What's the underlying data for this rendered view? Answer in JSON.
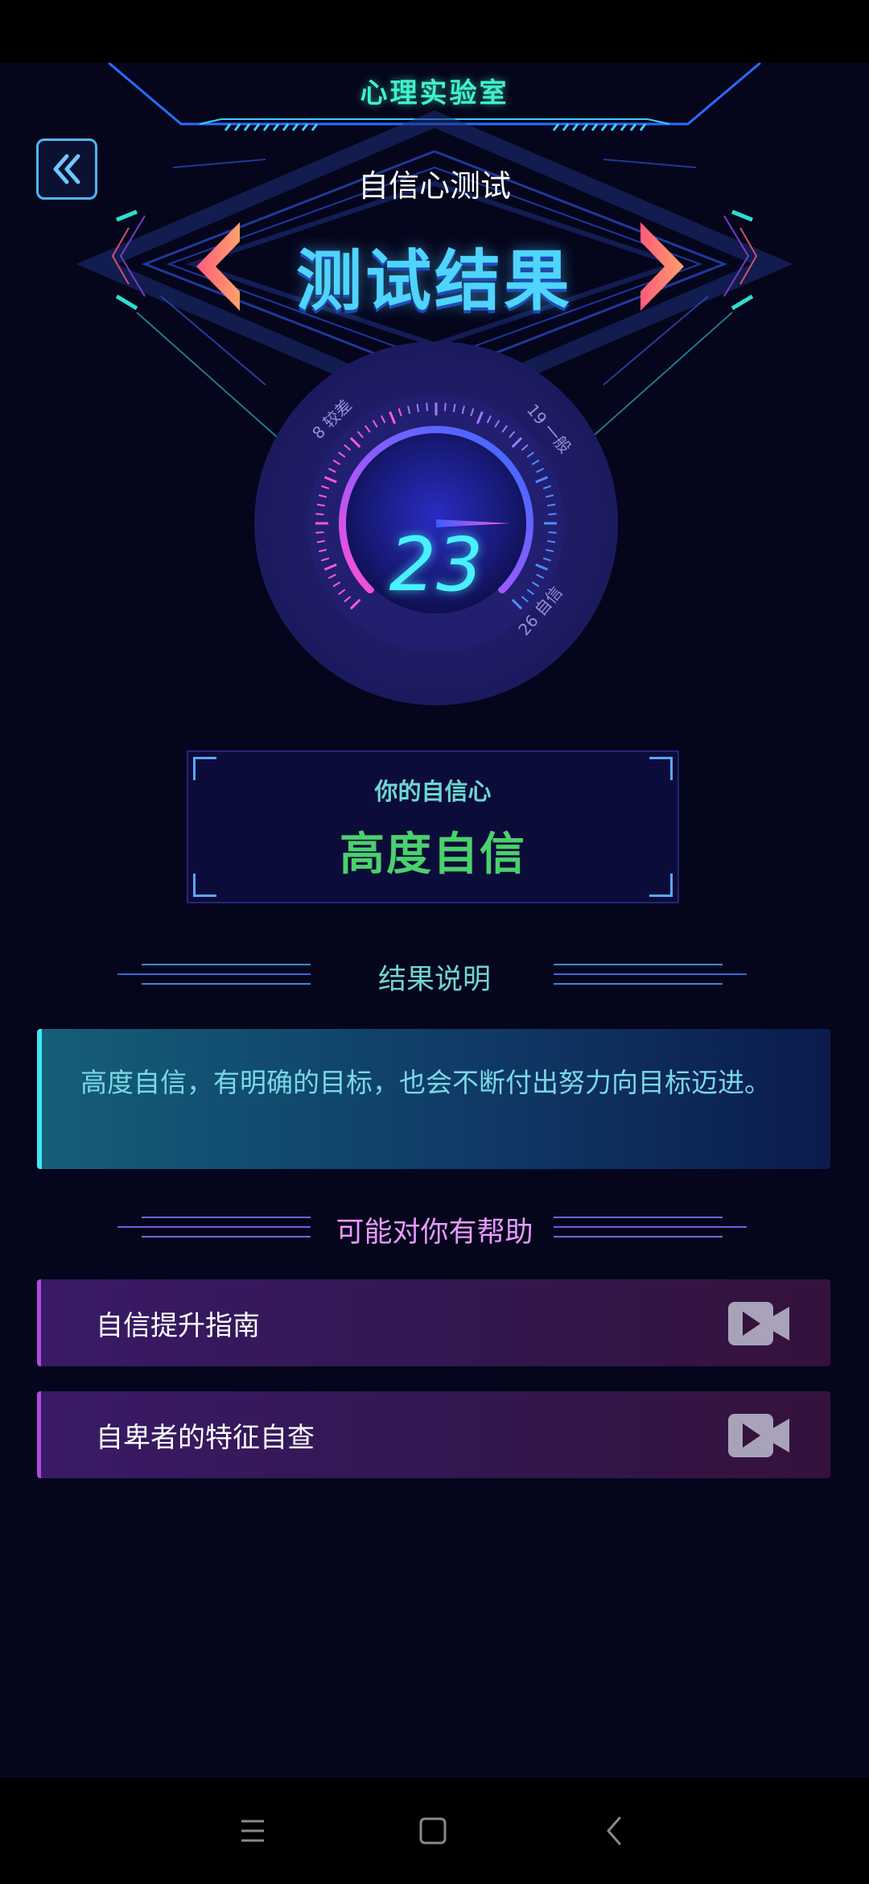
{
  "header": {
    "app_title": "心理实验室",
    "test_name": "自信心测试",
    "result_heading": "测试结果"
  },
  "gauge": {
    "score": "23",
    "score_value": 23,
    "range_min": 8,
    "range_max": 26,
    "labels": [
      {
        "value": "8",
        "text": "较差"
      },
      {
        "value": "19",
        "text": "一般"
      },
      {
        "value": "26",
        "text": "自信"
      }
    ],
    "colors": {
      "start": "#ff4fd8",
      "mid": "#8a5cff",
      "end": "#2f6dff"
    }
  },
  "result_card": {
    "label": "你的自信心",
    "value": "高度自信"
  },
  "explanation": {
    "section_title": "结果说明",
    "text": "高度自信，有明确的目标，也会不断付出努力向目标迈进。"
  },
  "help": {
    "section_title": "可能对你有帮助",
    "items": [
      {
        "label": "自信提升指南",
        "icon": "video-icon"
      },
      {
        "label": "自卑者的特征自查",
        "icon": "video-icon"
      }
    ]
  },
  "colors": {
    "accent_teal": "#3ff2c8",
    "accent_blue": "#4fd4ff",
    "result_green": "#4bd16c",
    "help_title": "#e79aff",
    "background": "#05051c"
  },
  "icons": {
    "back": "double-chevron-left-icon",
    "prev": "chevron-left-icon",
    "next": "chevron-right-icon",
    "nav_menu": "menu-icon",
    "nav_home": "square-home-icon",
    "nav_back": "back-chevron-icon"
  }
}
